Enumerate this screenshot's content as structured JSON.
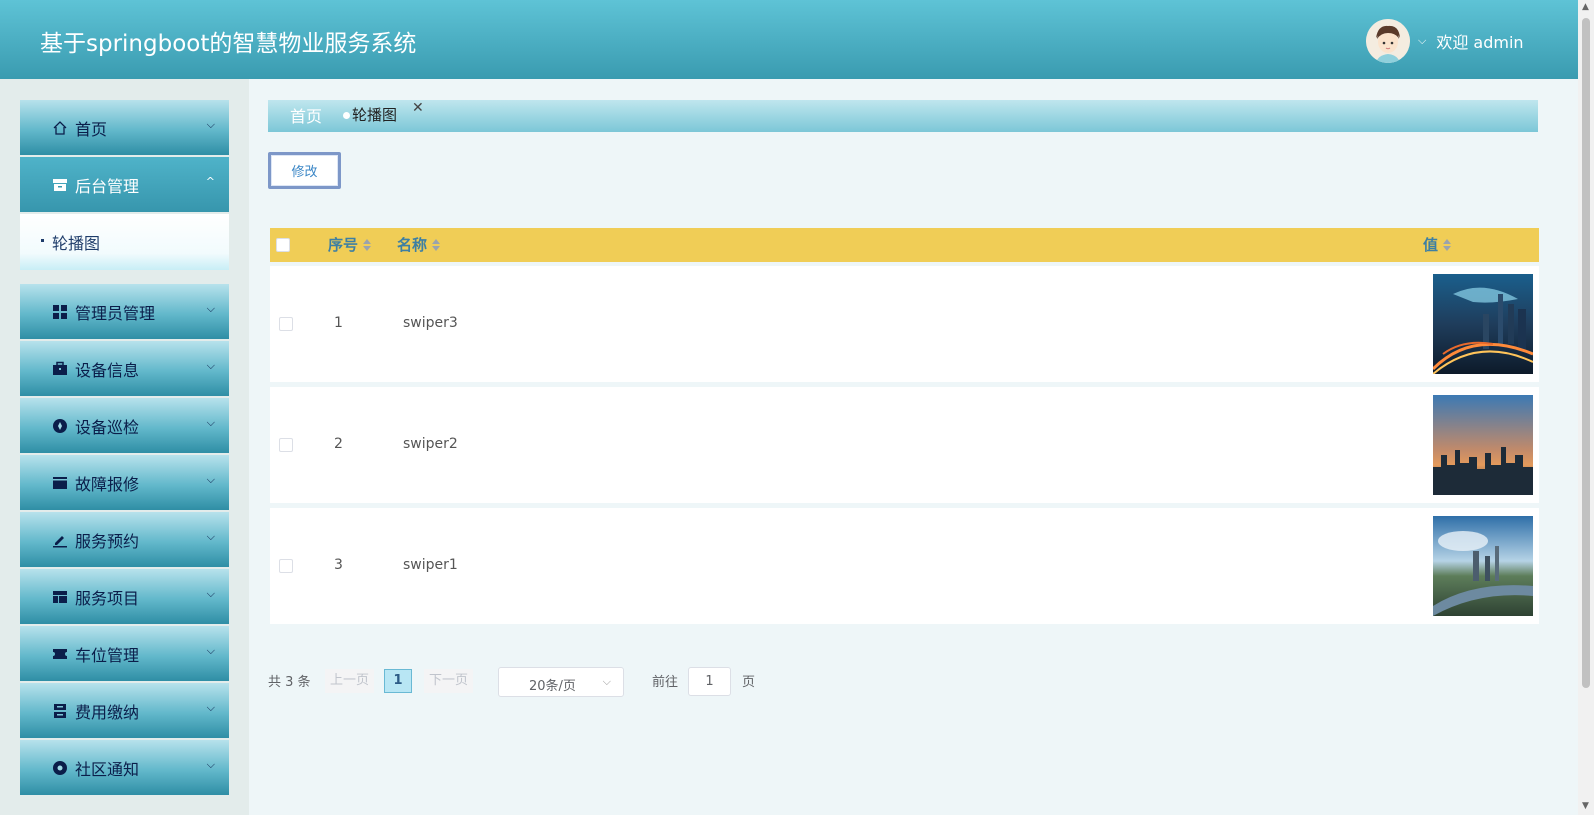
{
  "header": {
    "title": "基于springboot的智慧物业服务系统",
    "welcome": "欢迎 admin",
    "user_caret": "⌵"
  },
  "sidebar": {
    "items": [
      {
        "label": "首页",
        "icon": "home-icon",
        "caret": "⌵"
      },
      {
        "label": "后台管理",
        "icon": "archive-icon",
        "caret": "^"
      },
      {
        "label": "管理员管理",
        "icon": "grid-icon",
        "caret": "⌵"
      },
      {
        "label": "设备信息",
        "icon": "briefcase-icon",
        "caret": "⌵"
      },
      {
        "label": "设备巡检",
        "icon": "compass-icon",
        "caret": "⌵"
      },
      {
        "label": "故障报修",
        "icon": "card-icon",
        "caret": "⌵"
      },
      {
        "label": "服务预约",
        "icon": "edit-icon",
        "caret": "⌵"
      },
      {
        "label": "服务项目",
        "icon": "layout-icon",
        "caret": "⌵"
      },
      {
        "label": "车位管理",
        "icon": "ticket-icon",
        "caret": "⌵"
      },
      {
        "label": "费用缴纳",
        "icon": "server-icon",
        "caret": "⌵"
      },
      {
        "label": "社区通知",
        "icon": "record-icon",
        "caret": "⌵"
      }
    ],
    "submenu": {
      "label": "轮播图"
    }
  },
  "tabs": {
    "home": "首页",
    "active": "轮播图",
    "close": "✕"
  },
  "toolbar": {
    "edit_label": "修改"
  },
  "table": {
    "headers": {
      "no": "序号",
      "name": "名称",
      "value": "值"
    },
    "rows": [
      {
        "no": "1",
        "name": "swiper3",
        "image": "city-night-image"
      },
      {
        "no": "2",
        "name": "swiper2",
        "image": "city-sunset-image"
      },
      {
        "no": "3",
        "name": "swiper1",
        "image": "city-aerial-image"
      }
    ]
  },
  "pagination": {
    "total": "共 3 条",
    "prev": "上一页",
    "page": "1",
    "next": "下一页",
    "page_size": "20条/页",
    "goto_label": "前往",
    "goto_value": "1",
    "page_suffix": "页"
  },
  "colors": {
    "header": "#4fb3c9",
    "table_head": "#f0cd56",
    "accent": "#3d7fa3"
  }
}
